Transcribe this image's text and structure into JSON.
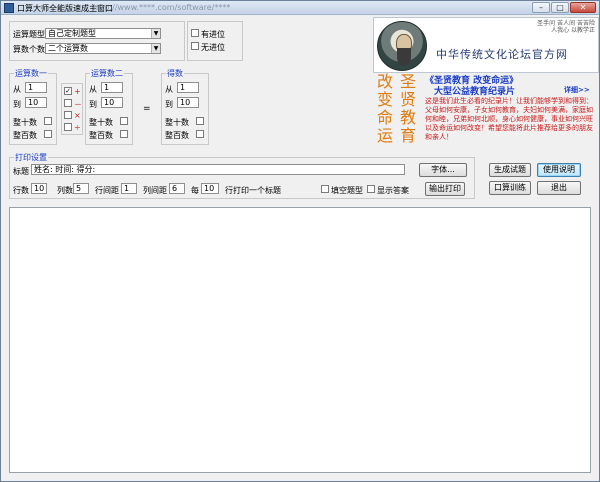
{
  "window": {
    "title": "口算大师全能版速成主窗口",
    "url": "http://www.****.com/software/****"
  },
  "top": {
    "type_label": "运算题型",
    "type_value": "自己定制题型",
    "count_label": "算数个数",
    "count_value": "二个运算数",
    "carry_label": "有进位",
    "no_carry_label": "无进位"
  },
  "operand1": {
    "title": "运算数一",
    "from_label": "从",
    "from_value": "1",
    "to_label": "到",
    "to_value": "10",
    "whole_ten_label": "整十数",
    "whole_hundred_label": "整百数"
  },
  "operators": [
    {
      "symbol": "+",
      "checked": true
    },
    {
      "symbol": "－",
      "checked": false
    },
    {
      "symbol": "×",
      "checked": false
    },
    {
      "symbol": "÷",
      "checked": false
    }
  ],
  "operand2": {
    "title": "运算数二",
    "from_label": "从",
    "from_value": "1",
    "to_label": "到",
    "to_value": "10",
    "whole_ten_label": "整十数",
    "whole_hundred_label": "整百数"
  },
  "equals": "=",
  "result": {
    "title": "得数",
    "from_label": "从",
    "from_value": "1",
    "to_label": "到",
    "to_value": "10",
    "whole_ten_label": "整十数",
    "whole_hundred_label": "整百数"
  },
  "print": {
    "title": "打印设置",
    "heading_label": "标题",
    "heading_value": "姓名:                      时间:                        得分:",
    "font_button": "字体...",
    "rows_label": "行数",
    "rows_value": "10",
    "cols_label": "列数",
    "cols_value": "5",
    "rowgap_label": "行间距",
    "rowgap_value": "1",
    "colgap_label": "列间距",
    "colgap_value": "6",
    "every_label": "每",
    "every_value": "10",
    "every_suffix": "行打印一个标题",
    "blank_label": "填空题型",
    "answer_label": "显示答案",
    "output_button": "输出打印"
  },
  "actions": {
    "generate": "生成试题",
    "help": "使用说明",
    "practice": "口算训练",
    "exit": "退出"
  },
  "banner": {
    "title": "中华传统文化论坛官方网",
    "small_1": "圣手问  苦人间  苦苦险",
    "small_2": "人我心  以教学正"
  },
  "promo": {
    "vertical_1": "圣贤教育",
    "vertical_2": "改变命运",
    "heading": "《圣贤教育 改变命运》",
    "subheading": "大型公益教育纪录片",
    "detail_link": "详细>>",
    "body": "这是我们此生必看的纪录片！让我们能够学到和得到：父母如何安康，子女如何教育，夫妇如何美满，家庭如何和睦，兄弟如何北顺，身心如何健康，事业如何兴旺以及命运如何改变！希望您能将此片推荐给更多的朋友和亲人！"
  },
  "colors": {
    "group_title": "#1a3cc8",
    "promo_orange": "#e07b10",
    "promo_red": "#c81818"
  }
}
